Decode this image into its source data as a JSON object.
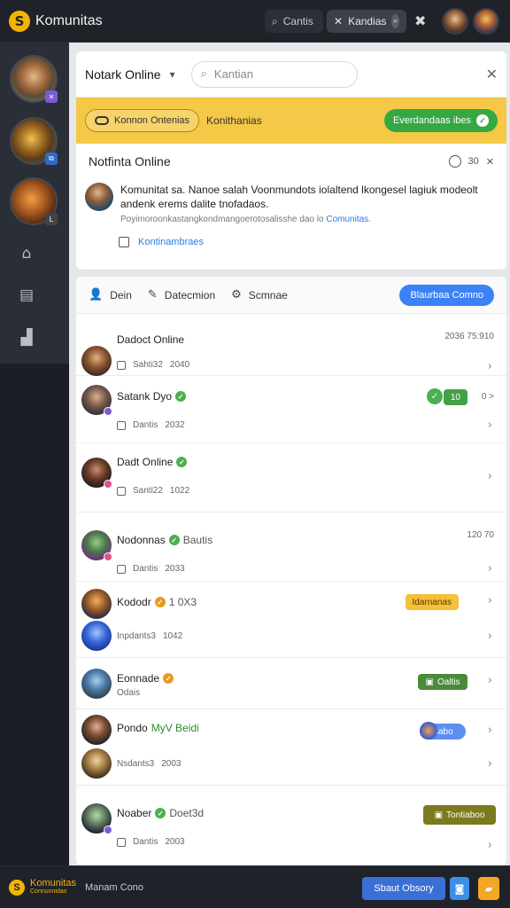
{
  "topbar": {
    "logo_mark": "S",
    "app_name": "Komunitas",
    "search_label": "Cantis",
    "active_tab_label": "Kandias"
  },
  "sidebar": {
    "badges": [
      "✕",
      "⧉",
      "L"
    ]
  },
  "panel": {
    "title": "Notark Online",
    "search_placeholder": "Kantian",
    "yellow_pill": "Konnon Ontenias",
    "yellow_text": "Konithanias",
    "green_button": "Everdandaas ibes"
  },
  "notification": {
    "title": "Notfinta Online",
    "count": "30",
    "line1": "Komunitat sa. Nanoe salah Voonmundots iolaltend lkongesel lagiuk modeolt andenk erems dalite tnofadaos.",
    "line2_prefix": "Poyimoroonkastangkondmangoerotosalisshe dao lo",
    "line2_link": "Comunitas.",
    "action_label": "Kontinambraes"
  },
  "filters": {
    "items": [
      {
        "icon": "👤",
        "label": "Dein"
      },
      {
        "icon": "✎",
        "label": "Datecmion"
      },
      {
        "icon": "⚙",
        "label": "Scmnae"
      }
    ],
    "blue_button": "Blaurbaa Comno"
  },
  "rows": [
    {
      "name": "Dadoct Online",
      "sub_a": "Sahti32",
      "sub_b": "2040",
      "time": "2036 75:910"
    },
    {
      "name": "Satank Dyo",
      "sub_a": "Dantis",
      "sub_b": "2032",
      "badge": "10",
      "time": "0 >"
    },
    {
      "name": "Dadt Online",
      "sub_a": "Santi22",
      "sub_b": "1022"
    },
    {
      "name": "Nodonnas",
      "name_extra": "Bautis",
      "sub_a": "Dantis",
      "sub_b": "2033",
      "time": "120 70"
    },
    {
      "name": "Kododr",
      "name_extra": "1 0X3",
      "sub_a": "Inpdants3",
      "sub_b": "1042",
      "tag": "Idarnanas"
    },
    {
      "name": "Eonnade",
      "sub_a": "Odais",
      "tag": "Oaltis"
    },
    {
      "name": "Pondo",
      "name_extra": "MyV Beidi",
      "sub_a": "Nsdants3",
      "sub_b": "2003",
      "tag": "Sabo"
    },
    {
      "name": "Noaber",
      "name_extra": "Doet3d",
      "sub_a": "Dantis",
      "sub_b": "2003",
      "tag": "Tontiaboo"
    }
  ],
  "bottombar": {
    "logo_mark": "S",
    "logo_title": "Komunitas",
    "logo_sub": "Connunnidas",
    "label": "Manam Cono",
    "button": "Sbaut Obsory"
  }
}
